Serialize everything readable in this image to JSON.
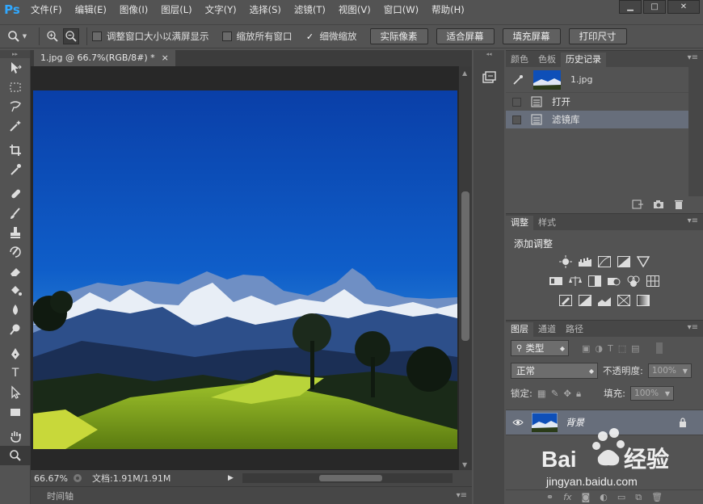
{
  "app": {
    "logo": "Ps"
  },
  "menu": [
    "文件(F)",
    "编辑(E)",
    "图像(I)",
    "图层(L)",
    "文字(Y)",
    "选择(S)",
    "滤镜(T)",
    "视图(V)",
    "窗口(W)",
    "帮助(H)"
  ],
  "window_controls": {
    "minimize": "▁",
    "restore": "□",
    "close": "✕"
  },
  "options": {
    "resize_windows": {
      "label": "调整窗口大小以满屏显示",
      "checked": false
    },
    "zoom_all": {
      "label": "缩放所有窗口",
      "checked": false
    },
    "scrubby": {
      "label": "细微缩放",
      "checked": true
    },
    "buttons": [
      "实际像素",
      "适合屏幕",
      "填充屏幕",
      "打印尺寸"
    ]
  },
  "document": {
    "tab_title": "1.jpg @ 66.7%(RGB/8#) *",
    "tab_close": "×",
    "zoom": "66.67%",
    "doc_size": "文档:1.91M/1.91M"
  },
  "timeline": {
    "label": "时间轴"
  },
  "history_panel": {
    "tabs": [
      "颜色",
      "色板",
      "历史记录"
    ],
    "active_tab": 2,
    "snapshot": "1.jpg",
    "items": [
      {
        "label": "打开",
        "selected": false
      },
      {
        "label": "滤镜库",
        "selected": true
      }
    ]
  },
  "adjust_panel": {
    "tabs": [
      "调整",
      "样式"
    ],
    "active_tab": 0,
    "title": "添加调整"
  },
  "layers_panel": {
    "tabs": [
      "图层",
      "通道",
      "路径"
    ],
    "active_tab": 0,
    "filter_label": "类型",
    "blend_mode": "正常",
    "opacity_label": "不透明度:",
    "opacity_value": "100%",
    "lock_label": "锁定:",
    "fill_label": "填充:",
    "fill_value": "100%",
    "layers": [
      {
        "name": "背景",
        "visible": true,
        "locked": true
      }
    ]
  },
  "watermark": {
    "brand": "Baidu经验",
    "url": "jingyan.baidu.com"
  },
  "colors": {
    "accent": "#30a8ff",
    "ui_bg": "#535353",
    "selection": "#676e7b"
  }
}
